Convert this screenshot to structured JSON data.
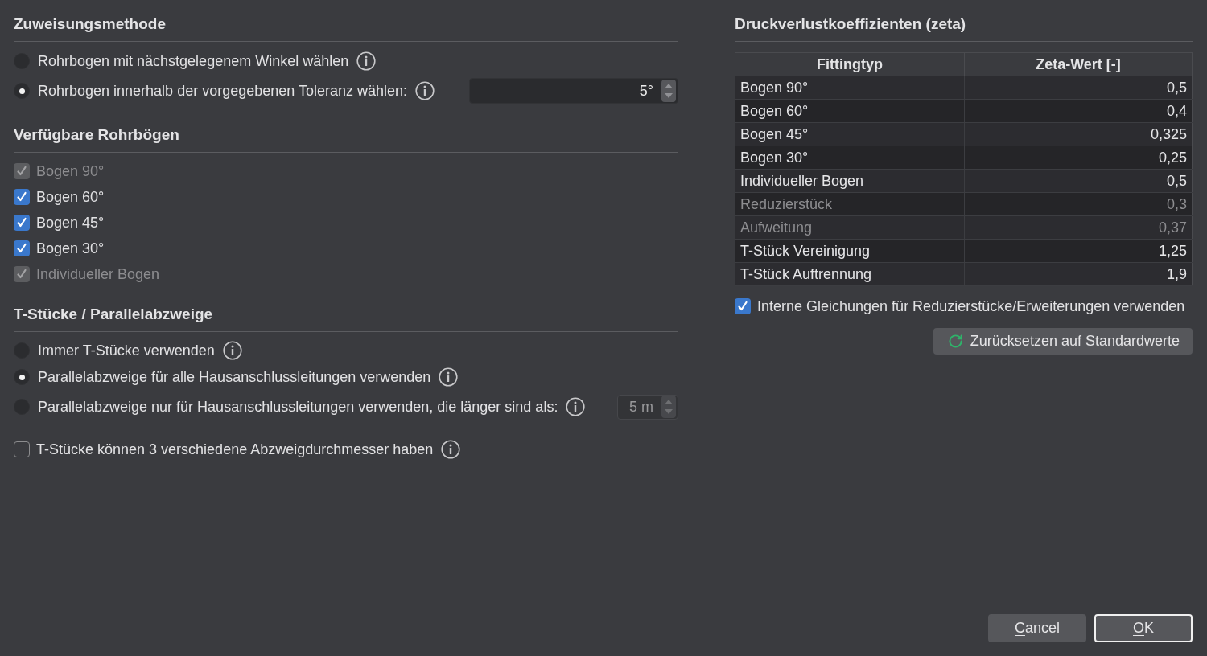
{
  "assignment_method": {
    "title": "Zuweisungsmethode",
    "options": [
      {
        "label": "Rohrbogen mit nächstgelegenem Winkel wählen",
        "selected": false,
        "info": true
      },
      {
        "label": "Rohrbogen innerhalb der vorgegebenen Toleranz wählen:",
        "selected": true,
        "info": true,
        "field": {
          "value": "5°",
          "disabled": false
        }
      }
    ]
  },
  "available_bends": {
    "title": "Verfügbare Rohrbögen",
    "items": [
      {
        "label": "Bogen 90°",
        "checked": true,
        "disabled": true
      },
      {
        "label": "Bogen 60°",
        "checked": true,
        "disabled": false
      },
      {
        "label": "Bogen 45°",
        "checked": true,
        "disabled": false
      },
      {
        "label": "Bogen 30°",
        "checked": true,
        "disabled": false
      },
      {
        "label": "Individueller Bogen",
        "checked": true,
        "disabled": true
      }
    ]
  },
  "tees": {
    "title": "T-Stücke / Parallelabzweige",
    "options": [
      {
        "label": "Immer T-Stücke verwenden",
        "selected": false,
        "info": true
      },
      {
        "label": "Parallelabzweige für alle Hausanschlussleitungen verwenden",
        "selected": true,
        "info": true
      },
      {
        "label": "Parallelabzweige nur für Hausanschlussleitungen verwenden, die länger sind als:",
        "selected": false,
        "info": true,
        "field": {
          "value": "5 m",
          "disabled": true
        }
      }
    ],
    "checkbox": {
      "label": "T-Stücke können 3 verschiedene Abzweigdurchmesser haben",
      "checked": false,
      "info": true
    }
  },
  "zeta": {
    "title": "Druckverlustkoeffizienten (zeta)",
    "table": {
      "columns": [
        "Fittingtyp",
        "Zeta-Wert [-]"
      ],
      "rows": [
        {
          "cells": [
            "Bogen 90°",
            "0,5"
          ],
          "disabled": false
        },
        {
          "cells": [
            "Bogen 60°",
            "0,4"
          ],
          "disabled": false
        },
        {
          "cells": [
            "Bogen 45°",
            "0,325"
          ],
          "disabled": false
        },
        {
          "cells": [
            "Bogen 30°",
            "0,25"
          ],
          "disabled": false
        },
        {
          "cells": [
            "Individueller Bogen",
            "0,5"
          ],
          "disabled": false
        },
        {
          "cells": [
            "Reduzierstück",
            "0,3"
          ],
          "disabled": true
        },
        {
          "cells": [
            "Aufweitung",
            "0,37"
          ],
          "disabled": true
        },
        {
          "cells": [
            "T-Stück Vereinigung",
            "1,25"
          ],
          "disabled": false
        },
        {
          "cells": [
            "T-Stück Auftrennung",
            "1,9"
          ],
          "disabled": false
        }
      ]
    },
    "checkbox": {
      "label": "Interne Gleichungen für Reduzierstücke/Erweiterungen verwenden",
      "checked": true
    },
    "reset_button": {
      "label": "Zurücksetzen auf Standardwerte"
    }
  },
  "buttons": [
    {
      "label": "Cancel",
      "default": false,
      "mnemonic_underlined": true
    },
    {
      "label": "OK",
      "default": true,
      "mnemonic_underlined": true
    }
  ]
}
